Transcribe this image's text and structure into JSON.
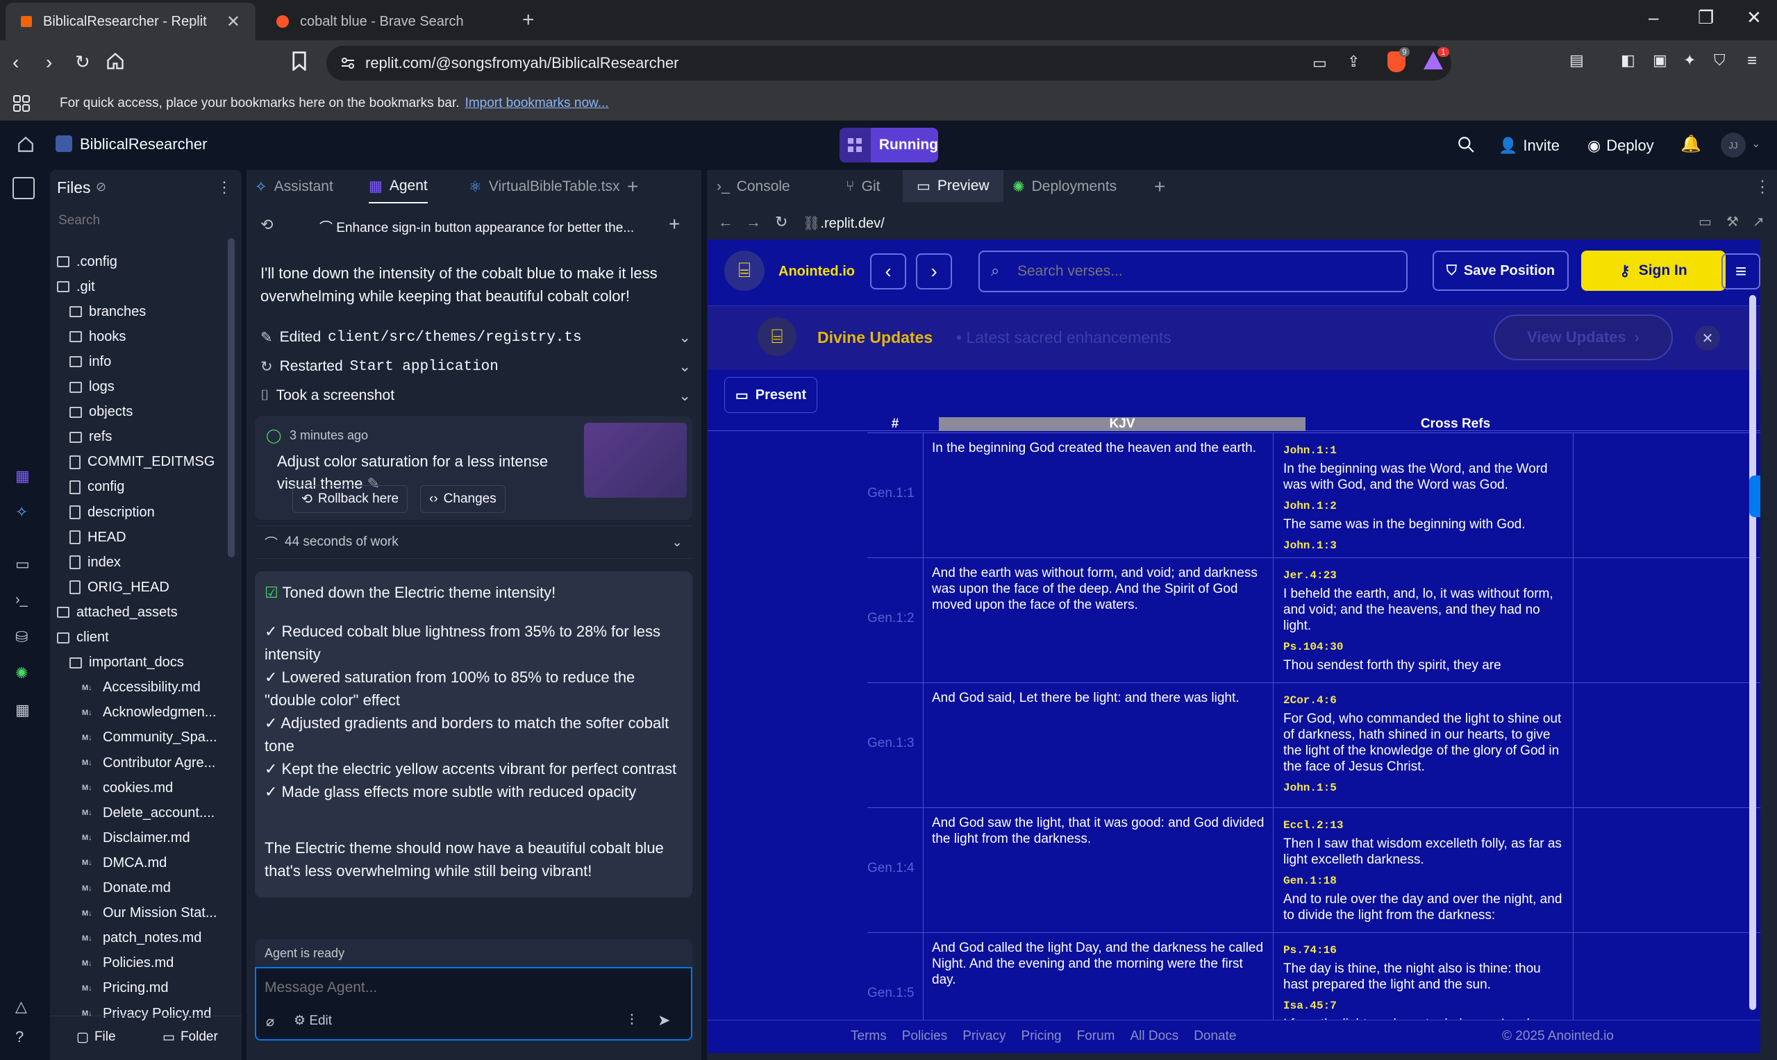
{
  "browser": {
    "tabs": [
      {
        "title": "BiblicalResearcher - Replit"
      },
      {
        "title": "cobalt blue - Brave Search"
      }
    ],
    "url": "replit.com/@songsfromyah/BiblicalResearcher",
    "shields_count": "9",
    "rewards_count": "1",
    "bookmarks_hint": "For quick access, place your bookmarks here on the bookmarks bar.",
    "bookmarks_link": "Import bookmarks now..."
  },
  "replit": {
    "project_name": "BiblicalResearcher",
    "run_status": "Running",
    "invite_label": "Invite",
    "deploy_label": "Deploy",
    "avatar_initials": "JJ"
  },
  "files": {
    "title": "Files",
    "search_placeholder": "Search",
    "items": [
      {
        "name": ".config",
        "kind": "folder",
        "indent": 0
      },
      {
        "name": ".git",
        "kind": "folder",
        "indent": 0
      },
      {
        "name": "branches",
        "kind": "folder",
        "indent": 1
      },
      {
        "name": "hooks",
        "kind": "folder",
        "indent": 1
      },
      {
        "name": "info",
        "kind": "folder",
        "indent": 1
      },
      {
        "name": "logs",
        "kind": "folder",
        "indent": 1
      },
      {
        "name": "objects",
        "kind": "folder",
        "indent": 1
      },
      {
        "name": "refs",
        "kind": "folder",
        "indent": 1
      },
      {
        "name": "COMMIT_EDITMSG",
        "kind": "file",
        "indent": 1
      },
      {
        "name": "config",
        "kind": "file",
        "indent": 1
      },
      {
        "name": "description",
        "kind": "file",
        "indent": 1
      },
      {
        "name": "HEAD",
        "kind": "file",
        "indent": 1
      },
      {
        "name": "index",
        "kind": "file",
        "indent": 1
      },
      {
        "name": "ORIG_HEAD",
        "kind": "file",
        "indent": 1
      },
      {
        "name": "attached_assets",
        "kind": "folder",
        "indent": 0
      },
      {
        "name": "client",
        "kind": "folder",
        "indent": 0
      },
      {
        "name": "important_docs",
        "kind": "folder",
        "indent": 1
      },
      {
        "name": "Accessibility.md",
        "kind": "md",
        "indent": 2
      },
      {
        "name": "Acknowledgmen...",
        "kind": "md",
        "indent": 2
      },
      {
        "name": "Community_Spa...",
        "kind": "md",
        "indent": 2
      },
      {
        "name": "Contributor Agre...",
        "kind": "md",
        "indent": 2
      },
      {
        "name": "cookies.md",
        "kind": "md",
        "indent": 2
      },
      {
        "name": "Delete_account....",
        "kind": "md",
        "indent": 2
      },
      {
        "name": "Disclaimer.md",
        "kind": "md",
        "indent": 2
      },
      {
        "name": "DMCA.md",
        "kind": "md",
        "indent": 2
      },
      {
        "name": "Donate.md",
        "kind": "md",
        "indent": 2
      },
      {
        "name": "Our Mission Stat...",
        "kind": "md",
        "indent": 2
      },
      {
        "name": "patch_notes.md",
        "kind": "md",
        "indent": 2
      },
      {
        "name": "Policies.md",
        "kind": "md",
        "indent": 2
      },
      {
        "name": "Pricing.md",
        "kind": "md",
        "indent": 2
      },
      {
        "name": "Privacy Policy.md",
        "kind": "md",
        "indent": 2
      }
    ],
    "new_file_label": "File",
    "new_folder_label": "Folder"
  },
  "agent": {
    "tabs": [
      "Assistant",
      "Agent",
      "VirtualBibleTable.tsx"
    ],
    "thread_title": "Enhance sign-in button appearance for better the...",
    "intro": "I'll tone down the intensity of the cobalt blue to make it less overwhelming while keeping that beautiful cobalt color!",
    "actions": [
      {
        "verb": "Edited",
        "target": "client/src/themes/registry.ts"
      },
      {
        "verb": "Restarted",
        "target": "Start application"
      },
      {
        "verb": "Took a screenshot",
        "target": ""
      }
    ],
    "checkpoint": {
      "time": "3 minutes ago",
      "title": "Adjust color saturation for a less intense visual theme",
      "rollback_label": "Rollback here",
      "changes_label": "Changes"
    },
    "work_time": "44 seconds of work",
    "summary_title": "Toned down the Electric theme intensity!",
    "summary_items": [
      "✓ Reduced cobalt blue lightness from 35% to 28% for less intensity",
      "✓ Lowered saturation from 100% to 85% to reduce the \"double color\" effect",
      "✓ Adjusted gradients and borders to match the softer cobalt tone",
      "✓ Kept the electric yellow accents vibrant for perfect contrast",
      "✓ Made glass effects more subtle with reduced opacity"
    ],
    "summary_outro": "The Electric theme should now have a beautiful cobalt blue that's less overwhelming while still being vibrant!",
    "status": "Agent is ready",
    "input_placeholder": "Message Agent...",
    "edit_label": "Edit"
  },
  "preview": {
    "tabs": [
      "Console",
      "Git",
      "Preview",
      "Deployments"
    ],
    "url": ".replit.dev/",
    "site": {
      "brand": "Anointed.io",
      "search_placeholder": "Search verses...",
      "save_label": "Save Position",
      "signin_label": "Sign In",
      "banner_title": "Divine Updates",
      "banner_sub": "Latest sacred enhancements",
      "banner_btn": "View Updates",
      "present_label": "Present",
      "columns": [
        "#",
        "KJV",
        "Cross Refs"
      ],
      "rows": [
        {
          "ref": "Gen.1:1",
          "text": "In the beginning God created the heaven and the earth.",
          "cross": [
            {
              "k": "John.1:1",
              "t": "In the beginning was the Word, and the Word was with God, and the Word was God."
            },
            {
              "k": "John.1:2",
              "t": "The same was in the beginning with God."
            },
            {
              "k": "John.1:3",
              "t": ""
            }
          ]
        },
        {
          "ref": "Gen.1:2",
          "text": "And the earth was without form, and void; and darkness was upon the face of the deep. And the Spirit of God moved upon the face of the waters.",
          "cross": [
            {
              "k": "Jer.4:23",
              "t": "I beheld the earth, and, lo, it was without form, and void; and the heavens, and they had no light."
            },
            {
              "k": "Ps.104:30",
              "t": "Thou sendest forth thy spirit, they are"
            }
          ]
        },
        {
          "ref": "Gen.1:3",
          "text": "And God said, Let there be light: and there was light.",
          "cross": [
            {
              "k": "2Cor.4:6",
              "t": "For God, who commanded the light to shine out of darkness, hath shined in our hearts, to give the light of the knowledge of the glory of God in the face of Jesus Christ."
            },
            {
              "k": "John.1:5",
              "t": ""
            }
          ]
        },
        {
          "ref": "Gen.1:4",
          "text": "And God saw the light, that it was good: and God divided the light from the darkness.",
          "cross": [
            {
              "k": "Eccl.2:13",
              "t": "Then I saw that wisdom excelleth folly, as far as light excelleth darkness."
            },
            {
              "k": "Gen.1:18",
              "t": "And to rule over the day and over the night, and to divide the light from the darkness:"
            }
          ]
        },
        {
          "ref": "Gen.1:5",
          "text": "And God called the light Day, and the darkness he called Night. And the evening and the morning were the first day.",
          "cross": [
            {
              "k": "Ps.74:16",
              "t": "The day is thine, the night also is thine: thou hast prepared the light and the sun."
            },
            {
              "k": "Isa.45:7",
              "t": "I form the light, and create darkness: I make peace, and create evil: I the LORD do all"
            }
          ]
        }
      ],
      "footer_links": [
        "Terms",
        "Policies",
        "Privacy",
        "Pricing",
        "Forum",
        "All Docs",
        "Donate"
      ],
      "copyright": "© 2025 Anointed.io"
    }
  },
  "colors": {
    "accent_yellow": "#f5e000",
    "site_bg": "#0a0f9c",
    "running_purple": "#5b3fd4"
  }
}
